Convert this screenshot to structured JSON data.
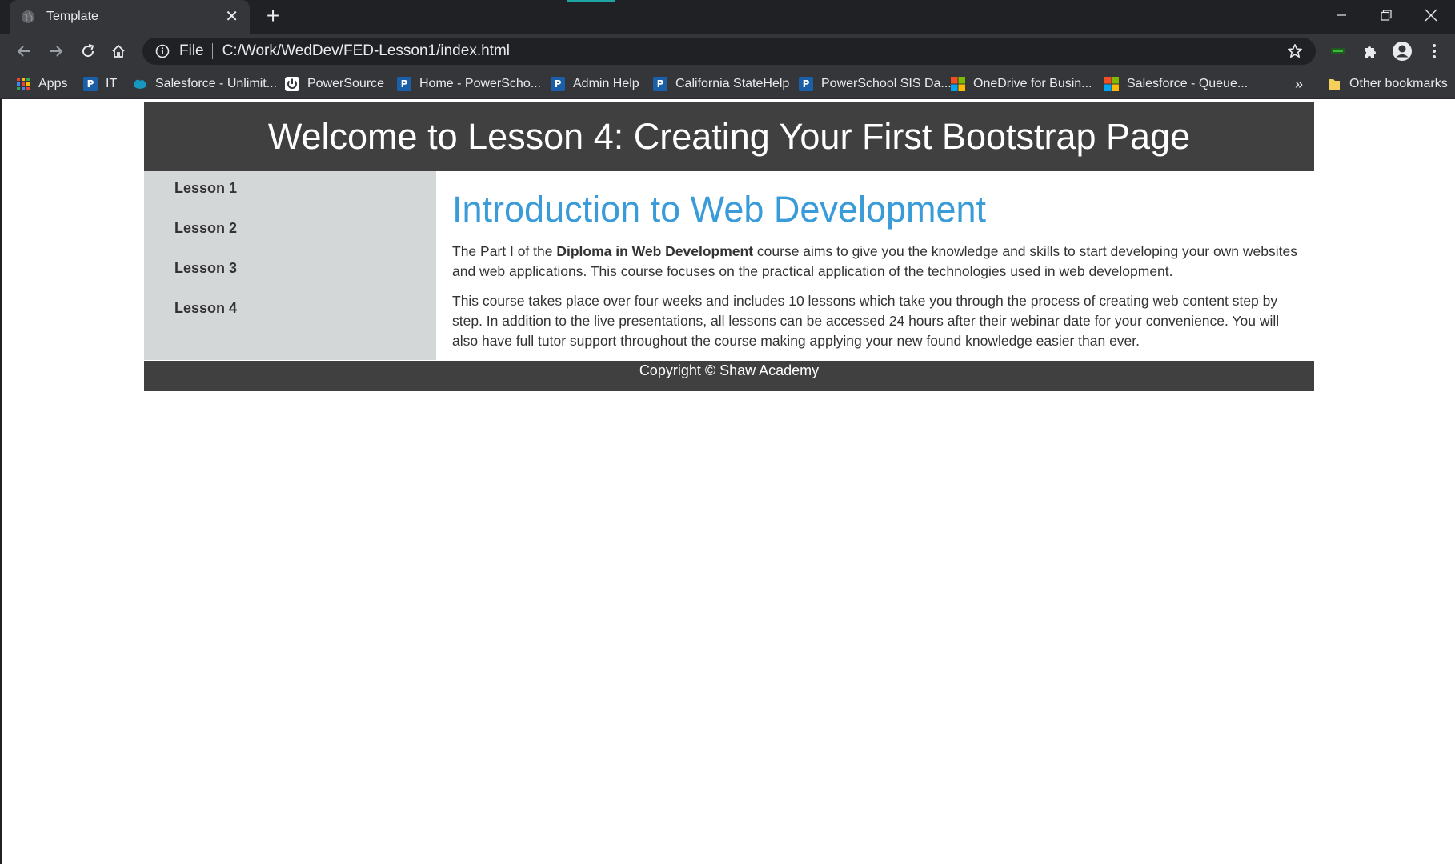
{
  "browser": {
    "tab": {
      "title": "Template"
    },
    "address": {
      "scheme": "File",
      "url": "C:/Work/WedDev/FED-Lesson1/index.html"
    },
    "bookmarks": [
      {
        "label": "Apps",
        "icon": "apps-grid-icon"
      },
      {
        "label": "IT",
        "icon": "powerschool-icon"
      },
      {
        "label": "Salesforce - Unlimit...",
        "icon": "salesforce-cloud-icon"
      },
      {
        "label": "PowerSource",
        "icon": "powersource-icon"
      },
      {
        "label": "Home - PowerScho...",
        "icon": "powerschool-icon"
      },
      {
        "label": "Admin Help",
        "icon": "powerschool-icon"
      },
      {
        "label": "California StateHelp",
        "icon": "powerschool-icon"
      },
      {
        "label": "PowerSchool SIS Da...",
        "icon": "powerschool-icon"
      },
      {
        "label": "OneDrive for Busin...",
        "icon": "microsoft-icon"
      },
      {
        "label": "Salesforce - Queue...",
        "icon": "microsoft-icon"
      }
    ],
    "overflow_label": "»",
    "other_bookmarks": "Other bookmarks",
    "colors": {
      "frame": "#202124",
      "toolbar": "#35363a",
      "text": "#e8eaed"
    }
  },
  "page": {
    "header_title": "Welcome to Lesson 4: Creating Your First Bootstrap Page",
    "nav": [
      {
        "label": "Lesson 1"
      },
      {
        "label": "Lesson 2"
      },
      {
        "label": "Lesson 3"
      },
      {
        "label": "Lesson 4"
      }
    ],
    "main": {
      "heading": "Introduction to Web Development",
      "p1": {
        "before": "The Part I of the ",
        "bold": "Diploma in Web Development",
        "after": " course aims to give you the knowledge and skills to start developing your own websites and web applications. This course focuses on the practical application of the technologies used in web development."
      },
      "p2": "This course takes place over four weeks and includes 10 lessons which take you through the process of creating web content step by step. In addition to the live presentations, all lessons can be accessed 24 hours after their webinar date for your convenience. You will also have full tutor support throughout the course making applying your new found knowledge easier than ever."
    },
    "footer": "Copyright © Shaw Academy",
    "colors": {
      "header_bg": "#404040",
      "sidebar_bg": "#d3d7d8",
      "heading": "#3a9bd9"
    }
  }
}
